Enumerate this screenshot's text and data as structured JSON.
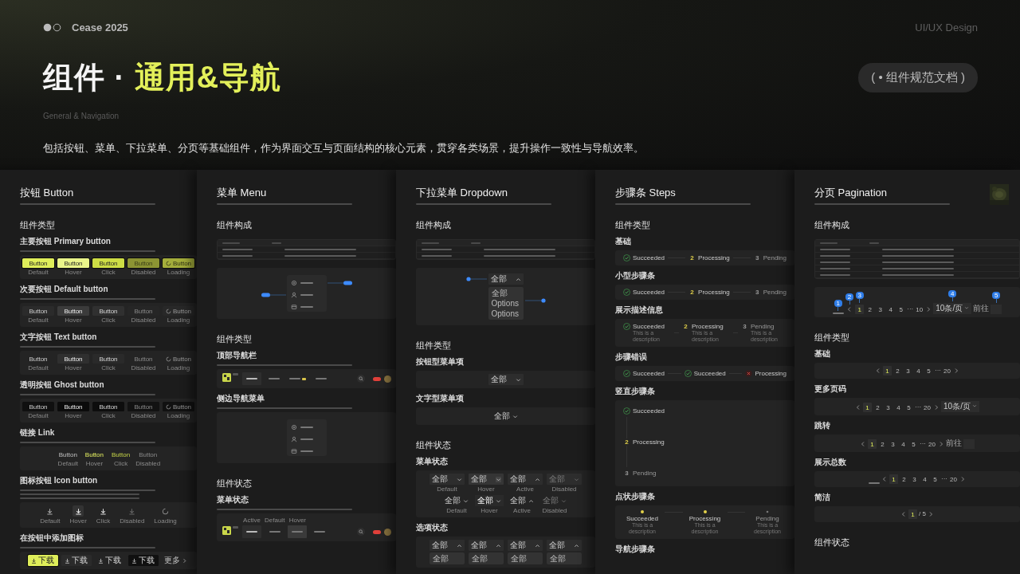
{
  "header": {
    "brand": "Cease 2025",
    "tag": "UI/UX Design",
    "title": "组件 · ",
    "title_accent": "通用&导航",
    "badge": "( • 组件规范文档 )",
    "subtitle": "General & Navigation",
    "description": "包括按钮、菜单、下拉菜单、分页等基础组件，作为界面交互与页面结构的核心元素，贯穿各类场景，提升操作一致性与导航效率。"
  },
  "panels": [
    {
      "title": "按钮 Button",
      "sections": [
        {
          "heading": "组件类型",
          "blocks": [
            {
              "label": "主要按钮 Primary button",
              "demo": {
                "kind": "primary_buttons",
                "items": [
                  {
                    "text": "Button",
                    "caption": "Default",
                    "kind": "default"
                  },
                  {
                    "text": "Button",
                    "caption": "Hover",
                    "kind": "hover"
                  },
                  {
                    "text": "Button",
                    "caption": "Click",
                    "kind": "click"
                  },
                  {
                    "text": "Button",
                    "caption": "Disabled",
                    "kind": "disabled"
                  },
                  {
                    "text": "Button",
                    "caption": "Loading",
                    "kind": "loading"
                  }
                ]
              }
            },
            {
              "label": "次要按钮 Default button",
              "demo": {
                "kind": "default_buttons",
                "items": [
                  {
                    "text": "Button",
                    "caption": "Default",
                    "kind": "default"
                  },
                  {
                    "text": "Button",
                    "caption": "Hover",
                    "kind": "hover"
                  },
                  {
                    "text": "Button",
                    "caption": "Click",
                    "kind": "click"
                  },
                  {
                    "text": "Button",
                    "caption": "Disabled",
                    "kind": "disabled"
                  },
                  {
                    "text": "Button",
                    "caption": "Loading",
                    "kind": "loading"
                  }
                ]
              }
            },
            {
              "label": "文字按钮 Text button",
              "demo": {
                "kind": "text_buttons",
                "items": [
                  {
                    "text": "Button",
                    "caption": "Default",
                    "kind": "default"
                  },
                  {
                    "text": "Button",
                    "caption": "Hover",
                    "kind": "hover"
                  },
                  {
                    "text": "Button",
                    "caption": "Click",
                    "kind": "click"
                  },
                  {
                    "text": "Button",
                    "caption": "Disabled",
                    "kind": "disabled"
                  },
                  {
                    "text": "Button",
                    "caption": "Loading",
                    "kind": "loading"
                  }
                ]
              }
            },
            {
              "label": "透明按钮 Ghost button",
              "demo": {
                "kind": "ghost_buttons",
                "items": [
                  {
                    "text": "Button",
                    "caption": "Default",
                    "kind": "default"
                  },
                  {
                    "text": "Button",
                    "caption": "Hover",
                    "kind": "hover"
                  },
                  {
                    "text": "Button",
                    "caption": "Click",
                    "kind": "click"
                  },
                  {
                    "text": "Button",
                    "caption": "Disabled",
                    "kind": "disabled"
                  },
                  {
                    "text": "Button",
                    "caption": "Loading",
                    "kind": "loading"
                  }
                ]
              }
            },
            {
              "label": "链接 Link",
              "demo": {
                "kind": "link_buttons",
                "items": [
                  {
                    "text": "Button",
                    "caption": "Default",
                    "kind": "default"
                  },
                  {
                    "text": "Button",
                    "caption": "Hover",
                    "kind": "hover"
                  },
                  {
                    "text": "Button",
                    "caption": "Click",
                    "kind": "click"
                  },
                  {
                    "text": "Button",
                    "caption": "Disabled",
                    "kind": "disabled"
                  }
                ]
              }
            },
            {
              "label": "图标按钮 Icon button",
              "demo": {
                "kind": "icon_buttons",
                "items": [
                  {
                    "caption": "Default",
                    "kind": "default"
                  },
                  {
                    "caption": "Hover",
                    "kind": "hover"
                  },
                  {
                    "caption": "Click",
                    "kind": "click"
                  },
                  {
                    "caption": "Disabled",
                    "kind": "disabled"
                  },
                  {
                    "caption": "Loading",
                    "kind": "loading"
                  }
                ]
              }
            },
            {
              "label": "在按钮中添加图标",
              "demo": {
                "kind": "icon_text_buttons",
                "items": [
                  {
                    "text": "下载",
                    "kind": "primary"
                  },
                  {
                    "text": "下载",
                    "kind": "default"
                  },
                  {
                    "text": "下载",
                    "kind": "text"
                  },
                  {
                    "text": "下载",
                    "kind": "ghost"
                  },
                  {
                    "text": "更多",
                    "kind": "link"
                  }
                ]
              }
            }
          ]
        }
      ]
    },
    {
      "title": "菜单 Menu",
      "sections": [
        {
          "heading": "组件构成",
          "blocks": [
            {
              "demo": {
                "kind": "table",
                "rows": [
                  {
                    "kind": "head"
                  },
                  {
                    "kind": "row"
                  },
                  {
                    "kind": "row"
                  }
                ]
              }
            },
            {
              "demo": {
                "kind": "menu",
                "items": [
                  {
                    "selected": false,
                    "kind": "callout_right"
                  },
                  {
                    "selected": false,
                    "kind": "callout_left"
                  },
                  {
                    "selected": false,
                    "kind": "plain"
                  }
                ]
              }
            }
          ]
        },
        {
          "heading": "组件类型",
          "blocks": [
            {
              "label": "顶部导航栏",
              "demo": {
                "kind": "navbar",
                "tabs": [
                  {
                    "selected": true
                  },
                  {
                    "selected": false
                  },
                  {
                    "selected": false,
                    "tagged": true
                  },
                  {
                    "selected": false
                  }
                ]
              }
            },
            {
              "label": "侧边导航菜单",
              "demo": {
                "kind": "menu",
                "items": [
                  {
                    "selected": false,
                    "kind": "plain"
                  },
                  {
                    "selected": false,
                    "kind": "plain"
                  },
                  {
                    "selected": false,
                    "kind": "plain"
                  }
                ]
              }
            }
          ]
        },
        {
          "heading": "组件状态",
          "blocks": [
            {
              "label": "菜单状态",
              "demo": {
                "kind": "navbar",
                "tabs": [
                  {
                    "selected": true,
                    "caption": "Active"
                  },
                  {
                    "selected": false,
                    "caption": "Default"
                  },
                  {
                    "selected": false,
                    "hovered": true,
                    "caption": "Hover"
                  },
                  {
                    "selected": false
                  }
                ]
              }
            }
          ]
        }
      ]
    },
    {
      "title": "下拉菜单 Dropdown",
      "sections": [
        {
          "heading": "组件构成",
          "blocks": [
            {
              "demo": {
                "kind": "table",
                "rows": [
                  {
                    "kind": "head"
                  },
                  {
                    "kind": "row"
                  },
                  {
                    "kind": "row"
                  }
                ]
              }
            },
            {
              "demo": {
                "kind": "dropdown_anatomy",
                "value": "全部",
                "options": [
                  "全部",
                  "Options",
                  "Options"
                ]
              }
            }
          ]
        },
        {
          "heading": "组件类型",
          "blocks": [
            {
              "label": "按钮型菜单项",
              "demo": {
                "kind": "dropdowns",
                "rows": [
                  {
                    "kind": "box",
                    "items": [
                      {
                        "value": "全部",
                        "kind": "default"
                      }
                    ]
                  }
                ]
              }
            },
            {
              "label": "文字型菜单项",
              "demo": {
                "kind": "dropdowns",
                "rows": [
                  {
                    "kind": "text",
                    "items": [
                      {
                        "value": "全部",
                        "kind": "default"
                      }
                    ]
                  }
                ]
              }
            }
          ]
        },
        {
          "heading": "组件状态",
          "blocks": [
            {
              "label": "菜单状态",
              "demo": {
                "kind": "dropdowns",
                "rows": [
                  {
                    "kind": "box",
                    "items": [
                      {
                        "value": "全部",
                        "kind": "default",
                        "caption": "Default"
                      },
                      {
                        "value": "全部",
                        "kind": "hover",
                        "caption": "Hover"
                      },
                      {
                        "value": "全部",
                        "kind": "active",
                        "caption": "Active"
                      },
                      {
                        "value": "全部",
                        "kind": "disabled",
                        "caption": "Disabled"
                      }
                    ]
                  },
                  {
                    "kind": "text",
                    "items": [
                      {
                        "value": "全部",
                        "kind": "default",
                        "caption": "Default"
                      },
                      {
                        "value": "全部",
                        "kind": "hover",
                        "caption": "Hover"
                      },
                      {
                        "value": "全部",
                        "kind": "active",
                        "caption": "Active"
                      },
                      {
                        "value": "全部",
                        "kind": "disabled",
                        "caption": "Disabled"
                      }
                    ]
                  }
                ]
              }
            },
            {
              "label": "选项状态",
              "demo": {
                "kind": "dropdowns",
                "rows": [
                  {
                    "kind": "box",
                    "items": [
                      {
                        "value": "全部",
                        "kind": "active",
                        "options": [
                          "全部"
                        ]
                      },
                      {
                        "value": "全部",
                        "kind": "active",
                        "options": [
                          "全部"
                        ]
                      },
                      {
                        "value": "全部",
                        "kind": "active",
                        "options": [
                          "全部"
                        ]
                      },
                      {
                        "value": "全部",
                        "kind": "active",
                        "options": [
                          "全部"
                        ]
                      }
                    ]
                  }
                ]
              }
            }
          ]
        }
      ]
    },
    {
      "title": "步骤条 Steps",
      "sections": [
        {
          "heading": "组件类型",
          "blocks": [
            {
              "label": "基础",
              "demo": {
                "kind": "steps",
                "items": [
                  {
                    "title": "Succeeded",
                    "kind": "finish"
                  },
                  {
                    "number": "2",
                    "title": "Processing",
                    "kind": "process"
                  },
                  {
                    "number": "3",
                    "title": "Pending",
                    "kind": "wait"
                  }
                ]
              }
            },
            {
              "label": "小型步骤条",
              "demo": {
                "kind": "small_steps",
                "items": [
                  {
                    "title": "Succeeded",
                    "kind": "finish"
                  },
                  {
                    "number": "2",
                    "title": "Processing",
                    "kind": "process"
                  },
                  {
                    "number": "3",
                    "title": "Pending",
                    "kind": "wait"
                  }
                ]
              }
            },
            {
              "label": "展示描述信息",
              "demo": {
                "kind": "steps",
                "items": [
                  {
                    "title": "Succeeded",
                    "kind": "finish",
                    "description": "This is a description"
                  },
                  {
                    "number": "2",
                    "title": "Processing",
                    "kind": "process",
                    "description": "This is a description"
                  },
                  {
                    "number": "3",
                    "title": "Pending",
                    "kind": "wait",
                    "description": "This is a description"
                  }
                ]
              }
            },
            {
              "label": "步骤错误",
              "demo": {
                "kind": "steps",
                "items": [
                  {
                    "title": "Succeeded",
                    "kind": "finish"
                  },
                  {
                    "title": "Succeeded",
                    "kind": "finish"
                  },
                  {
                    "title": "Processing",
                    "kind": "error"
                  }
                ]
              }
            },
            {
              "label": "竖直步骤条",
              "demo": {
                "kind": "vertical_steps",
                "items": [
                  {
                    "title": "Succeeded",
                    "kind": "finish"
                  },
                  {
                    "number": "2",
                    "title": "Processing",
                    "kind": "process"
                  },
                  {
                    "number": "3",
                    "title": "Pending",
                    "kind": "wait"
                  }
                ]
              }
            },
            {
              "label": "点状步骤条",
              "demo": {
                "kind": "dot_steps",
                "items": [
                  {
                    "title": "Succeeded",
                    "kind": "finish",
                    "description": "This is a description"
                  },
                  {
                    "title": "Processing",
                    "kind": "process",
                    "description": "This is a description"
                  },
                  {
                    "title": "Pending",
                    "kind": "wait",
                    "description": "This is a description"
                  }
                ]
              }
            },
            {
              "label": "导航步骤条"
            }
          ]
        }
      ]
    },
    {
      "title": "分页 Pagination",
      "thumbnail": {
        "kind": "picture"
      },
      "sections": [
        {
          "heading": "组件构成",
          "blocks": [
            {
              "demo": {
                "kind": "table",
                "rows": [
                  {
                    "kind": "head"
                  },
                  {
                    "kind": "row"
                  },
                  {
                    "kind": "row"
                  },
                  {
                    "kind": "row"
                  },
                  {
                    "kind": "row"
                  },
                  {
                    "kind": "row"
                  }
                ]
              }
            },
            {
              "demo": {
                "kind": "pager",
                "items": [
                  {
                    "kind": "total",
                    "marker": "1"
                  },
                  {
                    "kind": "prev",
                    "marker": "2"
                  },
                  {
                    "kind": "page",
                    "text": "1",
                    "selected": true,
                    "marker": "3"
                  },
                  {
                    "kind": "page",
                    "text": "2",
                    "selected": false
                  },
                  {
                    "kind": "page",
                    "text": "3",
                    "selected": false
                  },
                  {
                    "kind": "page",
                    "text": "4",
                    "selected": false
                  },
                  {
                    "kind": "page",
                    "text": "5",
                    "selected": false
                  },
                  {
                    "kind": "more",
                    "text": "···"
                  },
                  {
                    "kind": "page",
                    "text": "10",
                    "selected": false
                  },
                  {
                    "kind": "next"
                  },
                  {
                    "kind": "size",
                    "text": "10条/页",
                    "marker": "4"
                  },
                  {
                    "kind": "jump",
                    "text": "前往"
                  },
                  {
                    "kind": "input",
                    "marker": "5"
                  }
                ]
              }
            }
          ]
        },
        {
          "heading": "组件类型",
          "blocks": [
            {
              "label": "基础",
              "demo": {
                "kind": "pager",
                "items": [
                  {
                    "kind": "prev"
                  },
                  {
                    "kind": "page",
                    "text": "1",
                    "selected": true
                  },
                  {
                    "kind": "page",
                    "text": "2",
                    "selected": false
                  },
                  {
                    "kind": "page",
                    "text": "3",
                    "selected": false
                  },
                  {
                    "kind": "page",
                    "text": "4",
                    "selected": false
                  },
                  {
                    "kind": "page",
                    "text": "5",
                    "selected": false
                  },
                  {
                    "kind": "more",
                    "text": "···"
                  },
                  {
                    "kind": "page",
                    "text": "20",
                    "selected": false
                  },
                  {
                    "kind": "next"
                  }
                ]
              }
            },
            {
              "label": "更多页码",
              "demo": {
                "kind": "pager",
                "items": [
                  {
                    "kind": "prev"
                  },
                  {
                    "kind": "page",
                    "text": "1",
                    "selected": true
                  },
                  {
                    "kind": "page",
                    "text": "2",
                    "selected": false
                  },
                  {
                    "kind": "page",
                    "text": "3",
                    "selected": false
                  },
                  {
                    "kind": "page",
                    "text": "4",
                    "selected": false
                  },
                  {
                    "kind": "page",
                    "text": "5",
                    "selected": false
                  },
                  {
                    "kind": "more",
                    "text": "···"
                  },
                  {
                    "kind": "page",
                    "text": "20",
                    "selected": false
                  },
                  {
                    "kind": "next"
                  },
                  {
                    "kind": "size",
                    "text": "10条/页"
                  }
                ]
              }
            },
            {
              "label": "跳转",
              "demo": {
                "kind": "pager",
                "items": [
                  {
                    "kind": "prev"
                  },
                  {
                    "kind": "page",
                    "text": "1",
                    "selected": true
                  },
                  {
                    "kind": "page",
                    "text": "2",
                    "selected": false
                  },
                  {
                    "kind": "page",
                    "text": "3",
                    "selected": false
                  },
                  {
                    "kind": "page",
                    "text": "4",
                    "selected": false
                  },
                  {
                    "kind": "page",
                    "text": "5",
                    "selected": false
                  },
                  {
                    "kind": "more",
                    "text": "···"
                  },
                  {
                    "kind": "page",
                    "text": "20",
                    "selected": false
                  },
                  {
                    "kind": "next"
                  },
                  {
                    "kind": "jump",
                    "text": "前往"
                  },
                  {
                    "kind": "input"
                  }
                ]
              }
            },
            {
              "label": "展示总数",
              "demo": {
                "kind": "pager",
                "items": [
                  {
                    "kind": "total"
                  },
                  {
                    "kind": "prev"
                  },
                  {
                    "kind": "page",
                    "text": "1",
                    "selected": true
                  },
                  {
                    "kind": "page",
                    "text": "2",
                    "selected": false
                  },
                  {
                    "kind": "page",
                    "text": "3",
                    "selected": false
                  },
                  {
                    "kind": "page",
                    "text": "4",
                    "selected": false
                  },
                  {
                    "kind": "page",
                    "text": "5",
                    "selected": false
                  },
                  {
                    "kind": "more",
                    "text": "···"
                  },
                  {
                    "kind": "page",
                    "text": "20",
                    "selected": false
                  },
                  {
                    "kind": "next"
                  }
                ]
              }
            },
            {
              "label": "简洁",
              "demo": {
                "kind": "pager",
                "items": [
                  {
                    "kind": "prev"
                  },
                  {
                    "kind": "page",
                    "text": "1",
                    "selected": true
                  },
                  {
                    "kind": "text",
                    "text": "/ 5"
                  },
                  {
                    "kind": "next"
                  }
                ]
              }
            }
          ]
        },
        {
          "heading": "组件状态"
        }
      ]
    }
  ]
}
